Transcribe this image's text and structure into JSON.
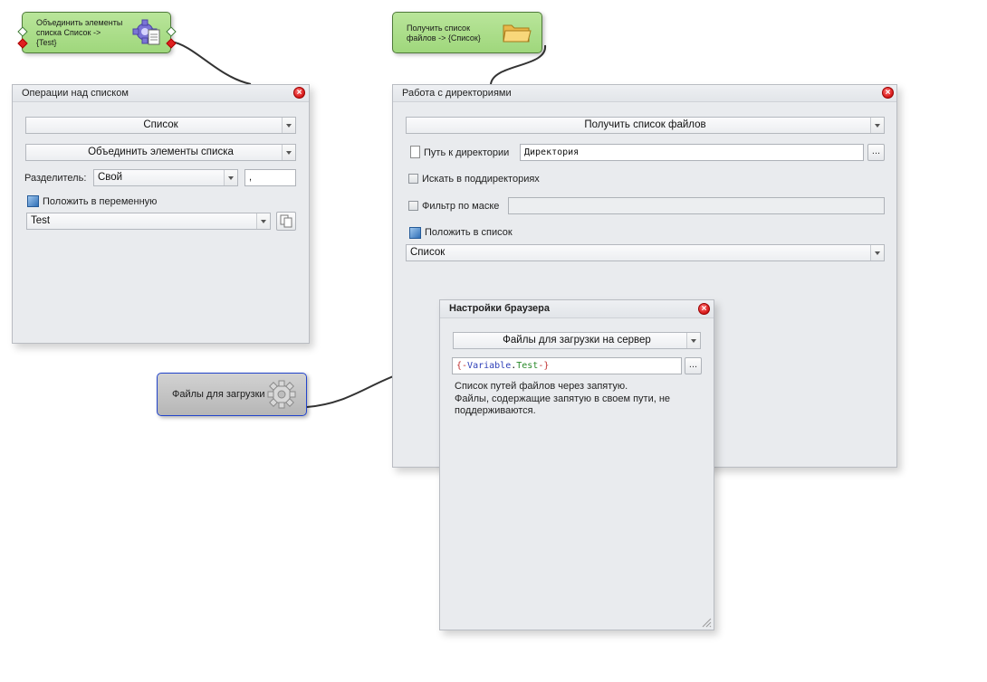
{
  "nodes": {
    "join": {
      "text": "Объединить элементы\nсписка Список ->\n{Test}"
    },
    "getfiles": {
      "text": "Получить список\nфайлов -> {Список}"
    },
    "upload": {
      "text": "Файлы для загрузки"
    }
  },
  "list_panel": {
    "title": "Операции над списком",
    "list_combo": "Список",
    "op_combo": "Объединить элементы списка",
    "separator_label": "Разделитель:",
    "separator_combo": "Свой",
    "separator_value": ",",
    "put_var_label": "Положить в переменную",
    "var_combo": "Test"
  },
  "dir_panel": {
    "title": "Работа с директориями",
    "op_combo": "Получить список файлов",
    "path_label": "Путь к директории",
    "path_value": "Директория",
    "browse_label": "...",
    "subdirs_label": "Искать в поддиректориях",
    "mask_label": "Фильтр по маске",
    "mask_value": "",
    "put_list_label": "Положить в список",
    "list_combo": "Список"
  },
  "browser_panel": {
    "title": "Настройки браузера",
    "op_combo": "Файлы для загрузки на сервер",
    "value_open": "{-",
    "value_var": "Variable",
    "value_dot": ".",
    "value_name": "Test",
    "value_close": "-}",
    "browse_label": "...",
    "help_text": "Список путей файлов через запятую.\nФайлы, содержащие запятую в своем пути, не\nподдерживаются."
  },
  "colors": {
    "node_green": "#a8dc86",
    "node_gray_border": "#2244cc",
    "close_red": "#d22222",
    "panel_bg": "#e9ebee"
  },
  "icons": [
    "gear-icon",
    "document-icon",
    "folder-icon",
    "close-icon",
    "chevron-down-icon",
    "copy-icon",
    "checkbox-icon",
    "resize-grip-icon"
  ]
}
